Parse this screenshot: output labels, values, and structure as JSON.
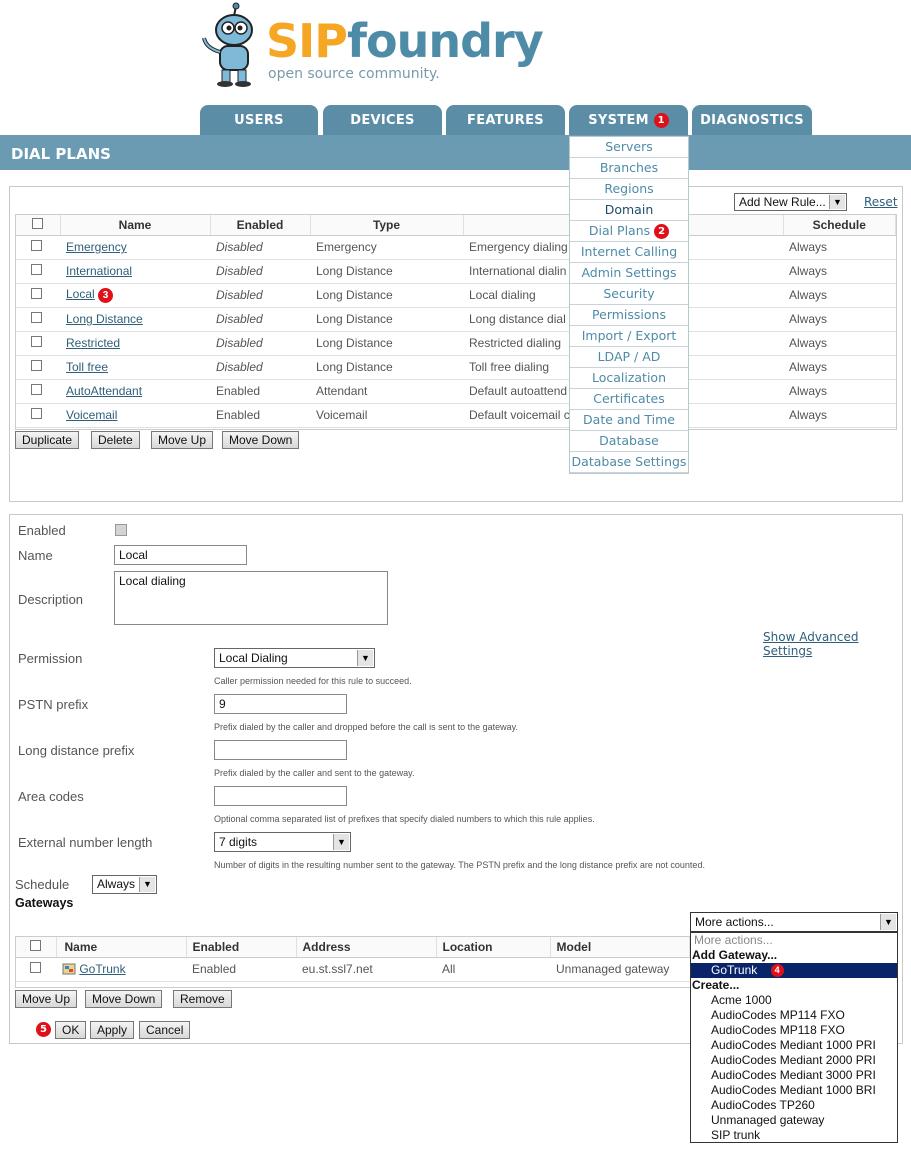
{
  "logo": {
    "brand_part1": "SIP",
    "brand_part2": "foundry",
    "tagline": "open source community."
  },
  "tabs": [
    {
      "label": "USERS"
    },
    {
      "label": "DEVICES"
    },
    {
      "label": "FEATURES"
    },
    {
      "label": "SYSTEM",
      "badge": "1"
    },
    {
      "label": "DIAGNOSTICS"
    }
  ],
  "page_title": "DIAL PLANS",
  "system_menu": [
    {
      "label": "Servers"
    },
    {
      "label": "Branches"
    },
    {
      "label": "Regions"
    },
    {
      "label": "Domain"
    },
    {
      "label": "Dial Plans",
      "badge": "2"
    },
    {
      "label": "Internet Calling"
    },
    {
      "label": "Admin Settings"
    },
    {
      "label": "Security"
    },
    {
      "label": "Permissions"
    },
    {
      "label": "Import / Export"
    },
    {
      "label": "LDAP / AD"
    },
    {
      "label": "Localization"
    },
    {
      "label": "Certificates"
    },
    {
      "label": "Date and Time"
    },
    {
      "label": "Database"
    },
    {
      "label": "Database Settings"
    }
  ],
  "rules_toolbar": {
    "add_new_rule": "Add New Rule...",
    "reset": "Reset"
  },
  "rules_table": {
    "headers": [
      "Name",
      "Enabled",
      "Type",
      "",
      "Schedule"
    ],
    "rows": [
      {
        "name": "Emergency",
        "enabled": "Disabled",
        "type": "Emergency",
        "desc": "Emergency dialing",
        "schedule": "Always"
      },
      {
        "name": "International",
        "enabled": "Disabled",
        "type": "Long Distance",
        "desc": "International dialin",
        "schedule": "Always"
      },
      {
        "name": "Local",
        "enabled": "Disabled",
        "type": "Long Distance",
        "desc": "Local dialing",
        "schedule": "Always",
        "badge": "3"
      },
      {
        "name": "Long Distance",
        "enabled": "Disabled",
        "type": "Long Distance",
        "desc": "Long distance dial",
        "schedule": "Always"
      },
      {
        "name": "Restricted",
        "enabled": "Disabled",
        "type": "Long Distance",
        "desc": "Restricted dialing",
        "schedule": "Always"
      },
      {
        "name": "Toll free",
        "enabled": "Disabled",
        "type": "Long Distance",
        "desc": "Toll free dialing",
        "schedule": "Always"
      },
      {
        "name": "AutoAttendant",
        "enabled": "Enabled",
        "type": "Attendant",
        "desc": "Default autoattend",
        "schedule": "Always"
      },
      {
        "name": "Voicemail",
        "enabled": "Enabled",
        "type": "Voicemail",
        "desc": "Default voicemail c",
        "schedule": "Always"
      }
    ]
  },
  "rules_buttons": {
    "duplicate": "Duplicate",
    "delete": "Delete",
    "move_up": "Move Up",
    "move_down": "Move Down"
  },
  "form": {
    "enabled_label": "Enabled",
    "name_label": "Name",
    "name_value": "Local",
    "description_label": "Description",
    "description_value": "Local dialing",
    "show_advanced": "Show Advanced Settings",
    "permission_label": "Permission",
    "permission_value": "Local Dialing",
    "permission_hint": "Caller permission needed for this rule to succeed.",
    "pstn_label": "PSTN prefix",
    "pstn_value": "9",
    "pstn_hint": "Prefix dialed by the caller and dropped before the call is sent to the gateway.",
    "ld_label": "Long distance prefix",
    "ld_value": "",
    "ld_hint": "Prefix dialed by the caller and sent to the gateway.",
    "area_label": "Area codes",
    "area_value": "",
    "area_hint": "Optional comma separated list of prefixes that specify dialed numbers to which this rule applies.",
    "ext_label": "External number length",
    "ext_value": "7 digits",
    "ext_hint": "Number of digits in the resulting number sent to the gateway. The PSTN prefix and the long distance prefix are not counted.",
    "schedule_label": "Schedule",
    "schedule_value": "Always",
    "gateways_heading": "Gateways"
  },
  "more_actions": {
    "selected": "More actions...",
    "items": [
      {
        "kind": "item",
        "label": "More actions...",
        "muted": true
      },
      {
        "kind": "group",
        "label": "Add Gateway..."
      },
      {
        "kind": "item",
        "label": "GoTrunk",
        "highlighted": true,
        "badge": "4"
      },
      {
        "kind": "group",
        "label": "Create..."
      },
      {
        "kind": "item",
        "label": "Acme 1000"
      },
      {
        "kind": "item",
        "label": "AudioCodes MP114 FXO"
      },
      {
        "kind": "item",
        "label": "AudioCodes MP118 FXO"
      },
      {
        "kind": "item",
        "label": "AudioCodes Mediant 1000 PRI"
      },
      {
        "kind": "item",
        "label": "AudioCodes Mediant 2000 PRI"
      },
      {
        "kind": "item",
        "label": "AudioCodes Mediant 3000 PRI"
      },
      {
        "kind": "item",
        "label": "AudioCodes Mediant 1000 BRI"
      },
      {
        "kind": "item",
        "label": "AudioCodes TP260"
      },
      {
        "kind": "item",
        "label": "Unmanaged gateway"
      },
      {
        "kind": "item",
        "label": "SIP trunk"
      }
    ]
  },
  "gateway_table": {
    "headers": [
      "Name",
      "Enabled",
      "Address",
      "Location",
      "Model"
    ],
    "row": {
      "name": "GoTrunk",
      "enabled": "Enabled",
      "address": "eu.st.ssl7.net",
      "location": "All",
      "model": "Unmanaged gateway"
    }
  },
  "gateway_buttons": {
    "move_up": "Move Up",
    "move_down": "Move Down",
    "remove": "Remove"
  },
  "footer_buttons": {
    "badge": "5",
    "ok": "OK",
    "apply": "Apply",
    "cancel": "Cancel"
  }
}
